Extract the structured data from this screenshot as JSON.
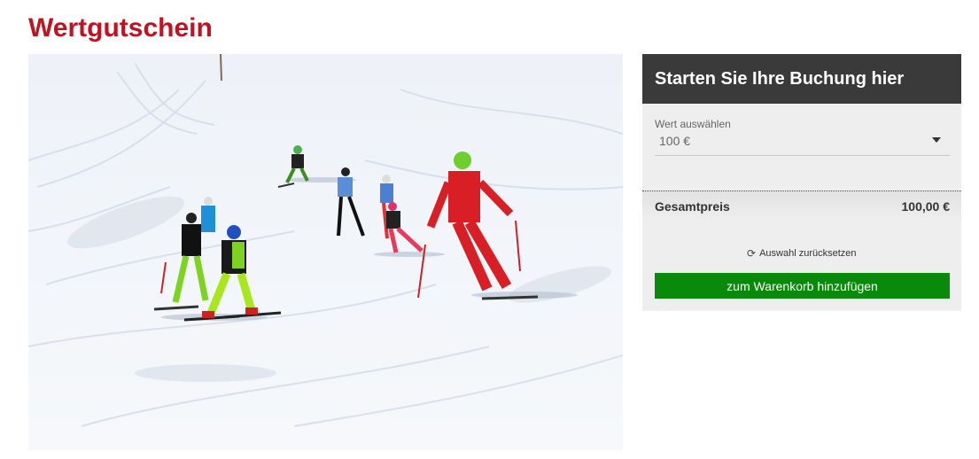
{
  "page": {
    "title": "Wertgutschein"
  },
  "hero_image": {
    "alt": "Skilehrer mit Kindergruppe auf der Piste"
  },
  "booking": {
    "header": "Starten Sie Ihre Buchung hier",
    "value_label": "Wert auswählen",
    "value_selected": "100 €",
    "total_label": "Gesamtpreis",
    "total_value": "100,00 €",
    "reset_label": "Auswahl zurücksetzen",
    "cart_button": "zum Warenkorb hinzufügen"
  },
  "colors": {
    "title": "#c1121f",
    "header_bg": "#3a3a3a",
    "panel_bg": "#eeeeee",
    "button_bg": "#0a8a0a"
  }
}
